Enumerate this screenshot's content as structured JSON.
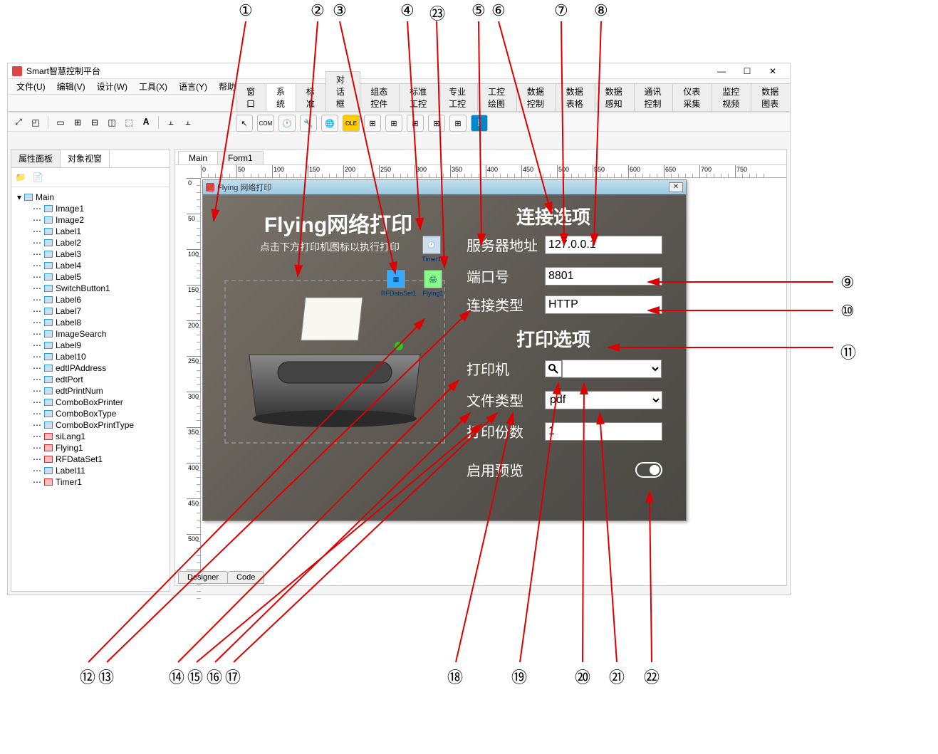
{
  "app": {
    "title": "Smart智慧控制平台"
  },
  "menu": {
    "file": "文件(U)",
    "edit": "编辑(V)",
    "design": "设计(W)",
    "tool": "工具(X)",
    "lang": "语言(Y)",
    "help": "帮助(Z)"
  },
  "tooltabs": [
    "窗口",
    "系统",
    "标准",
    "对话框",
    "组态控件",
    "标准工控",
    "专业工控",
    "工控绘图",
    "数据控制",
    "数据表格",
    "数据感知",
    "通讯控制",
    "仪表采集",
    "监控视频",
    "数据图表"
  ],
  "tooltab_active": 1,
  "left": {
    "tab1": "属性面板",
    "tab2": "对象视窗",
    "root": "Main",
    "items": [
      "Image1",
      "Image2",
      "Label1",
      "Label2",
      "Label3",
      "Label4",
      "Label5",
      "SwitchButton1",
      "Label6",
      "Label7",
      "Label8",
      "ImageSearch",
      "Label9",
      "Label10",
      "edtIPAddress",
      "edtPort",
      "edtPrintNum",
      "ComboBoxPrinter",
      "ComboBoxType",
      "ComboBoxPrintType",
      "siLang1",
      "Flying1",
      "RFDataSet1",
      "Label11",
      "Timer1"
    ]
  },
  "docs": {
    "tab1": "Main",
    "tab2": "Form1"
  },
  "form": {
    "caption": "Flying 网络打印",
    "title": "Flying网络打印",
    "subtitle": "点击下方打印机图标以执行打印",
    "conn_title": "连接选项",
    "row_addr": "服务器地址",
    "val_addr": "127.0.0.1",
    "row_port": "端口号",
    "val_port": "8801",
    "row_type": "连接类型",
    "val_type": "HTTP",
    "print_title": "打印选项",
    "row_printer": "打印机",
    "val_printer": "",
    "row_ftype": "文件类型",
    "val_ftype": "pdf",
    "row_copies": "打印份数",
    "val_copies": "1",
    "row_preview": "启用预览",
    "comp": {
      "timer": "Timer1",
      "rfdata": "RFDataSet1",
      "flying": "Flying1"
    }
  },
  "bottom": {
    "designer": "Designer",
    "code": "Code"
  },
  "callouts": {
    "1": "①",
    "2": "②",
    "3": "③",
    "4": "④",
    "5": "⑤",
    "6": "⑥",
    "7": "⑦",
    "8": "⑧",
    "9": "⑨",
    "10": "⑩",
    "11": "⑪",
    "12": "⑫",
    "13": "⑬",
    "14": "⑭",
    "15": "⑮",
    "16": "⑯",
    "17": "⑰",
    "18": "⑱",
    "19": "⑲",
    "20": "⑳",
    "21": "㉑",
    "22": "㉒",
    "23": "㉓"
  }
}
